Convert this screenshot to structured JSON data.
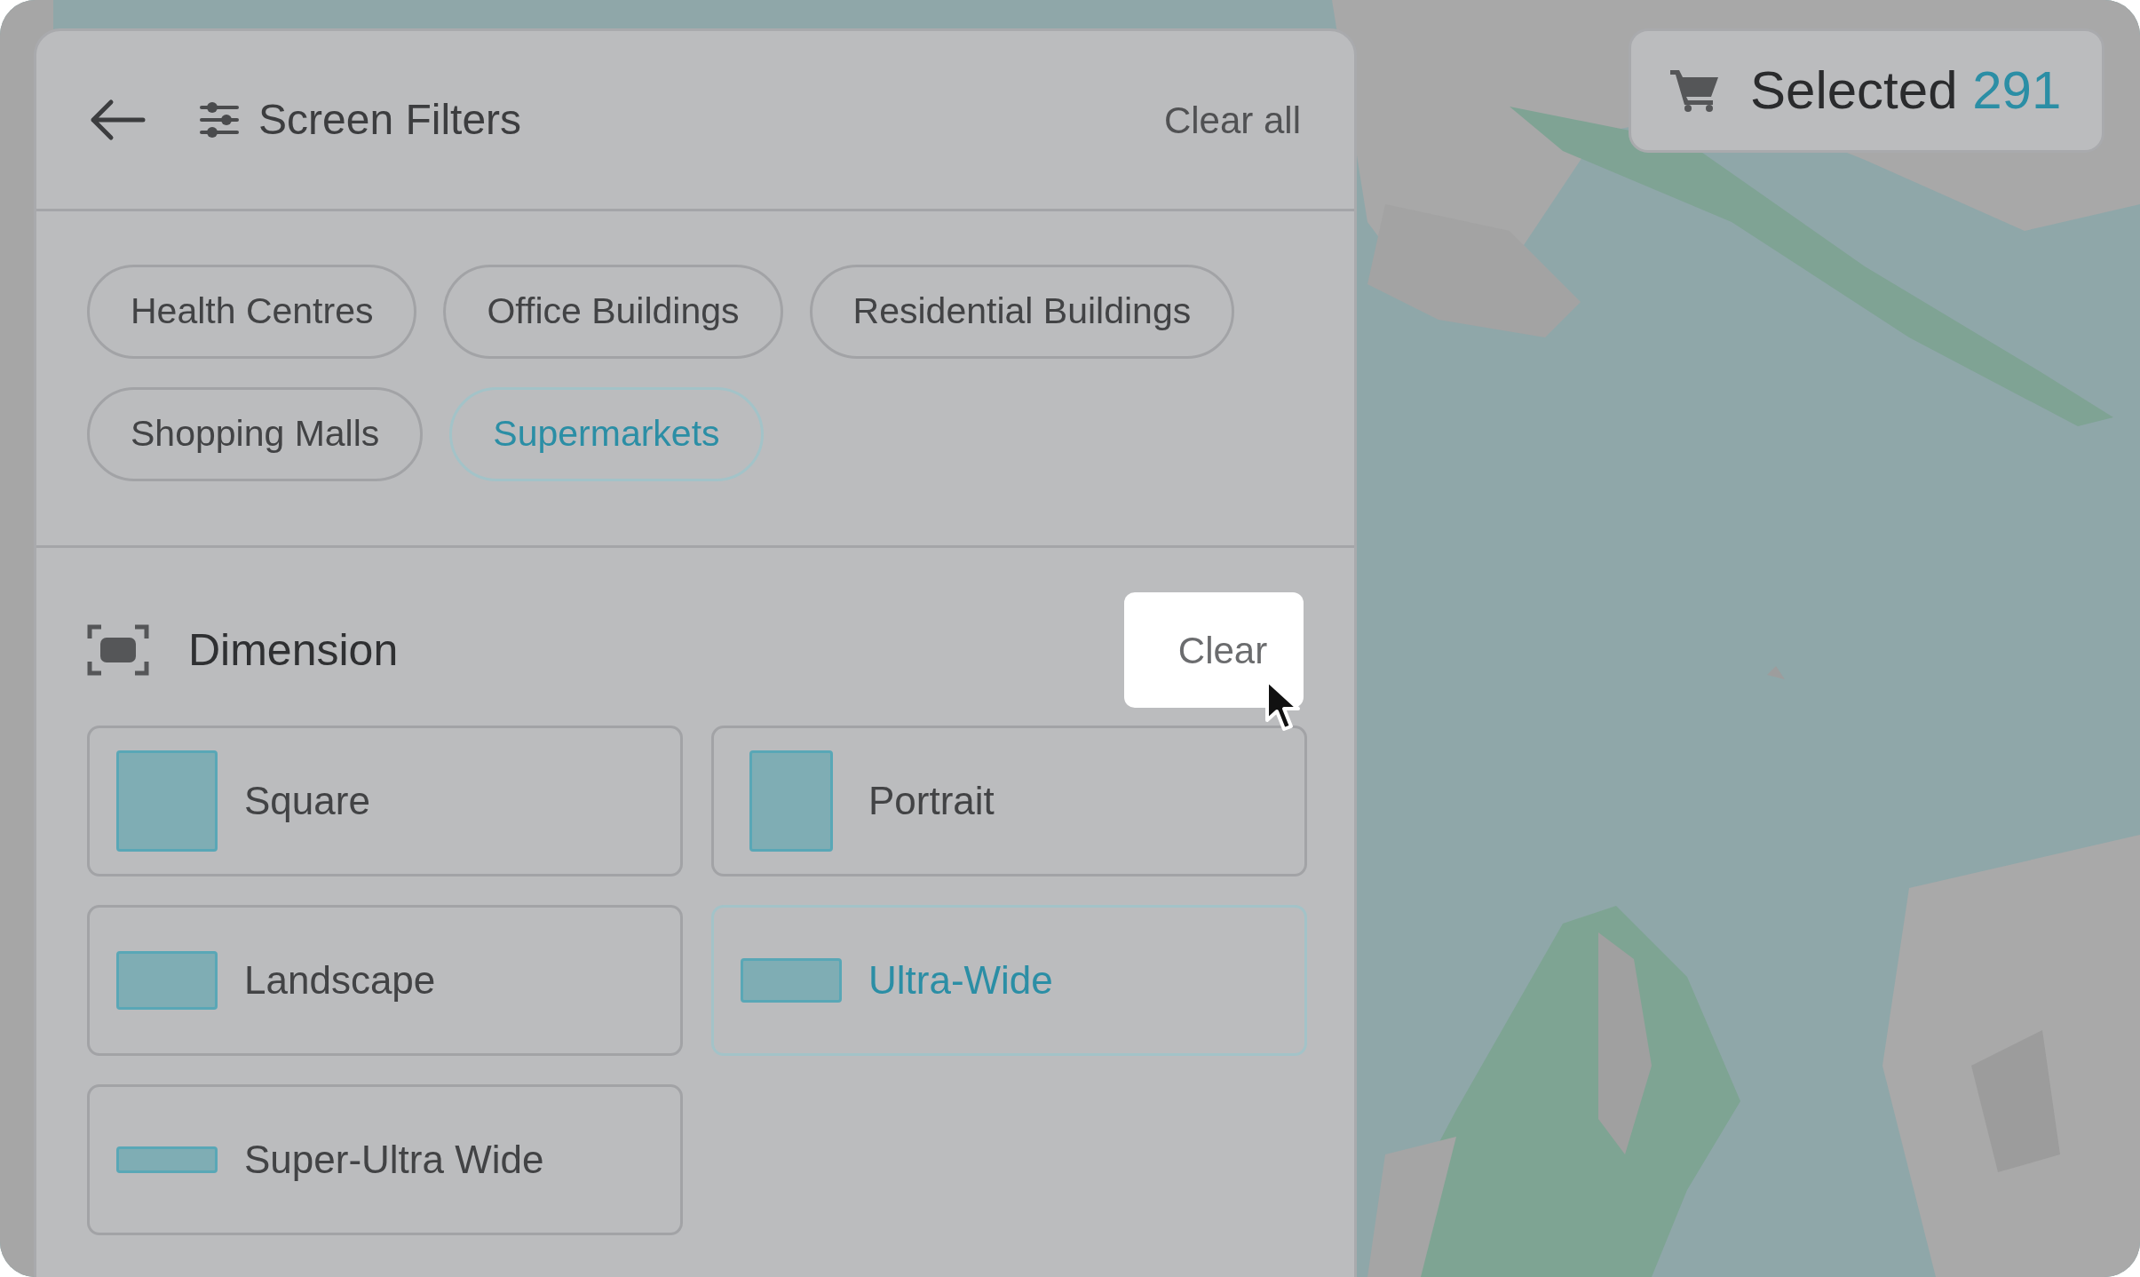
{
  "header": {
    "title": "Screen Filters",
    "clear_all": "Clear all"
  },
  "categories": [
    {
      "label": "Health Centres",
      "selected": false
    },
    {
      "label": "Office Buildings",
      "selected": false
    },
    {
      "label": "Residential Buildings",
      "selected": false
    },
    {
      "label": "Shopping Malls",
      "selected": false
    },
    {
      "label": "Supermarkets",
      "selected": true
    }
  ],
  "dimension": {
    "title": "Dimension",
    "clear": "Clear",
    "options": [
      {
        "label": "Square",
        "kind": "square",
        "selected": false
      },
      {
        "label": "Portrait",
        "kind": "portrait",
        "selected": false
      },
      {
        "label": "Landscape",
        "kind": "landscape",
        "selected": false
      },
      {
        "label": "Ultra-Wide",
        "kind": "ultrawide",
        "selected": true
      },
      {
        "label": "Super-Ultra Wide",
        "kind": "superultrawide",
        "selected": false
      }
    ]
  },
  "cart": {
    "label": "Selected",
    "count": "291"
  }
}
